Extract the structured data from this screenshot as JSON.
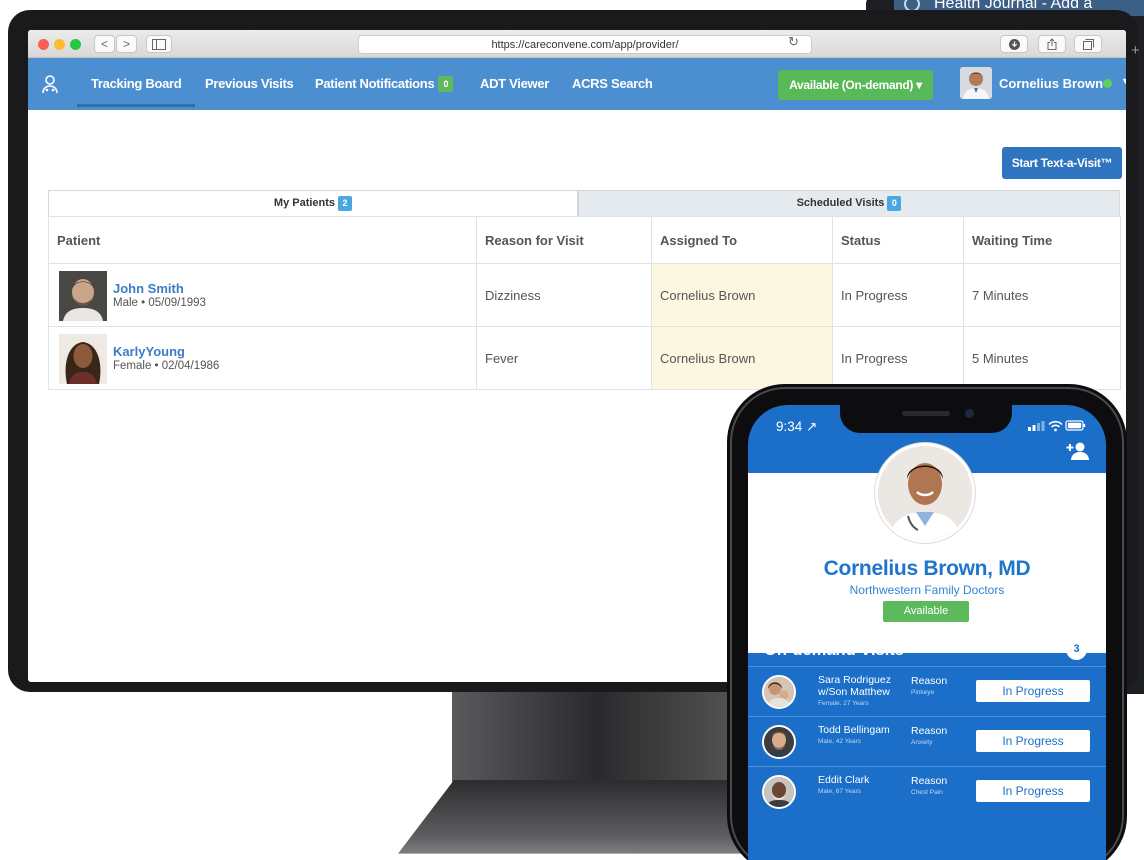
{
  "background_window": {
    "title": "Health Journal - Add a"
  },
  "browser": {
    "url": "https://careconvene.com/app/provider/",
    "back_glyph": "<",
    "forward_glyph": ">",
    "reload_glyph": "↻",
    "plus_glyph": "+"
  },
  "nav": {
    "items": [
      {
        "label": "Tracking Board",
        "active": true
      },
      {
        "label": "Previous Visits"
      },
      {
        "label": "Patient Notifications",
        "badge": "0"
      },
      {
        "label": "ADT Viewer"
      },
      {
        "label": "ACRS Search"
      }
    ],
    "availability": "Available (On-demand) ▾",
    "user_name": "Cornelius Brown",
    "caret": "▼"
  },
  "actions": {
    "start_text_visit": "Start Text-a-Visit™"
  },
  "tabs": [
    {
      "label": "My Patients",
      "badge": "2"
    },
    {
      "label": "Scheduled Visits",
      "badge": "0"
    }
  ],
  "table": {
    "columns": [
      "Patient",
      "Reason for Visit",
      "Assigned To",
      "Status",
      "Waiting Time"
    ],
    "rows": [
      {
        "name": "John Smith",
        "meta": "Male • 05/09/1993",
        "reason": "Dizziness",
        "assigned": "Cornelius Brown",
        "status": "In Progress",
        "waiting": "7 Minutes"
      },
      {
        "name": "KarlyYoung",
        "meta": "Female • 02/04/1986",
        "reason": "Fever",
        "assigned": "Cornelius Brown",
        "status": "In Progress",
        "waiting": "5 Minutes"
      }
    ]
  },
  "phone": {
    "time": "9:34 ↗",
    "doctor_name": "Cornelius Brown, MD",
    "organization": "Northwestern Family Doctors",
    "status": "Available",
    "on_demand": {
      "title": "On-demand Visits",
      "count": "3",
      "visits": [
        {
          "name": "Sara Rodriguez w/Son Matthew",
          "meta": "Female, 27 Years",
          "reason_label": "Reason",
          "reason": "Pinkeye",
          "status": "In Progress"
        },
        {
          "name": "Todd Bellingam",
          "meta": "Male, 42 Years",
          "reason_label": "Reason",
          "reason": "Anxiety",
          "status": "In Progress"
        },
        {
          "name": "Eddit Clark",
          "meta": "Male, 67 Years",
          "reason_label": "Reason",
          "reason": "Chest Pain",
          "status": "In Progress"
        }
      ]
    }
  },
  "colors": {
    "nav_blue": "#4c8fd1",
    "available_green": "#57b957",
    "primary_button": "#2f74be",
    "link_blue": "#3b7cc4",
    "assigned_highlight": "#fcf7e1",
    "phone_blue": "#1b6fc9"
  },
  "icons": [
    "stethoscope-user-icon",
    "back-icon",
    "forward-icon",
    "sidebar-icon",
    "reload-icon",
    "download-icon",
    "share-icon",
    "tabs-icon",
    "add-user-icon",
    "location-arrow-icon",
    "signal-icon",
    "wifi-icon",
    "battery-icon"
  ]
}
